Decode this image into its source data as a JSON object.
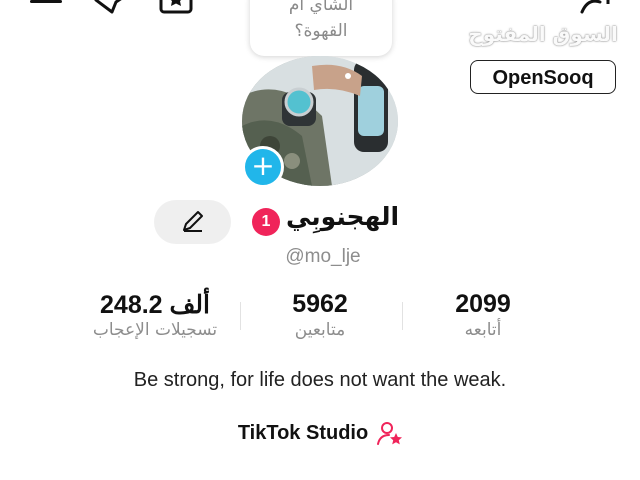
{
  "header": {
    "bubble_line1": "الشاي أم",
    "bubble_line2": "القهوة؟"
  },
  "watermark": {
    "arabic": "السوق المفتوح",
    "english": "OpenSooq"
  },
  "profile": {
    "display_name": "الهجنوبِي",
    "notification_count": "1",
    "username": "@mo_lje",
    "bio": "Be strong, for life does not want the weak.",
    "studio_label": "TikTok Studio"
  },
  "stats": {
    "likes_value": "248.2 ألف",
    "likes_label": "تسجيلات الإعجاب",
    "followers_value": "5962",
    "followers_label": "متابعين",
    "following_value": "2099",
    "following_label": "أتابعه"
  },
  "colors": {
    "accent_blue": "#21b6ea",
    "badge_red": "#f0245a",
    "studio_pink": "#f0245a"
  },
  "icons": [
    "menu-icon",
    "share-icon",
    "star-box-icon",
    "add-user-icon",
    "pencil-icon",
    "plus-icon",
    "user-star-icon"
  ]
}
